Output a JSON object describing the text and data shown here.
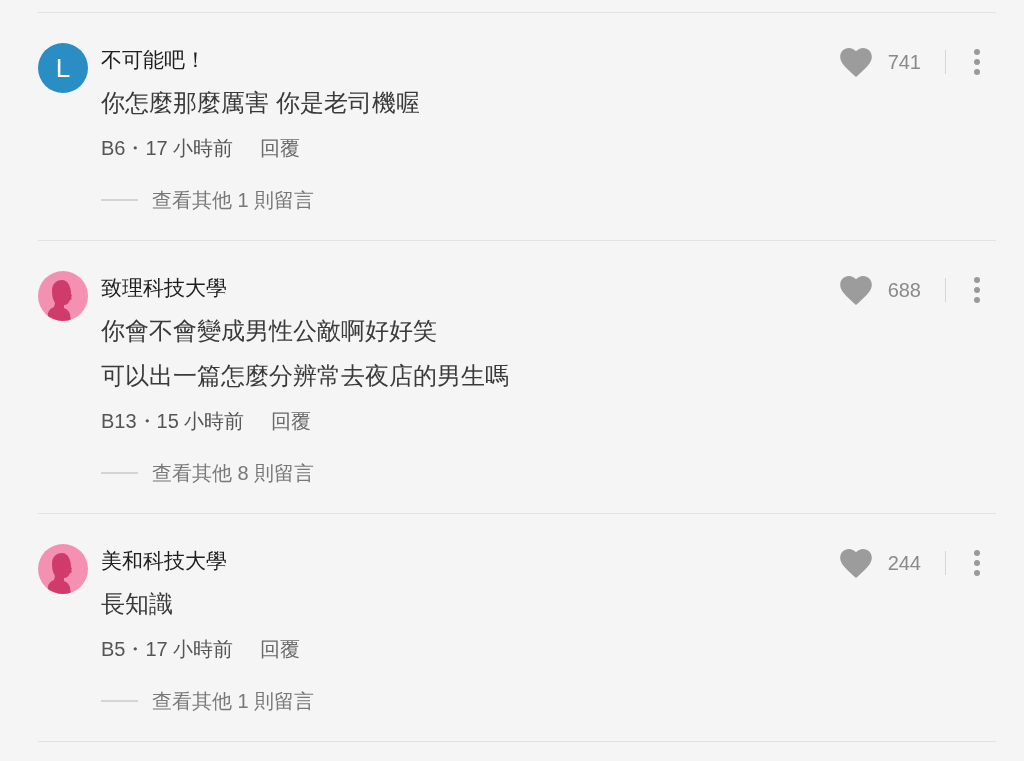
{
  "comments": [
    {
      "author": "不可能吧！",
      "avatar": {
        "kind": "letter",
        "letter": "L",
        "color": "#2a8ec4"
      },
      "body": [
        "你怎麼那麼厲害 你是老司機喔"
      ],
      "meta": "B6・17 小時前",
      "reply": "回覆",
      "more_replies": "查看其他 1 則留言",
      "likes": "741"
    },
    {
      "author": "致理科技大學",
      "avatar": {
        "kind": "silhouette",
        "color": "#f490b1"
      },
      "body": [
        "你會不會變成男性公敵啊好好笑",
        "可以出一篇怎麼分辨常去夜店的男生嗎"
      ],
      "meta": "B13・15 小時前",
      "reply": "回覆",
      "more_replies": "查看其他 8 則留言",
      "likes": "688"
    },
    {
      "author": "美和科技大學",
      "avatar": {
        "kind": "silhouette",
        "color": "#f490b1"
      },
      "body": [
        "長知識"
      ],
      "meta": "B5・17 小時前",
      "reply": "回覆",
      "more_replies": "查看其他 1 則留言",
      "likes": "244"
    }
  ]
}
